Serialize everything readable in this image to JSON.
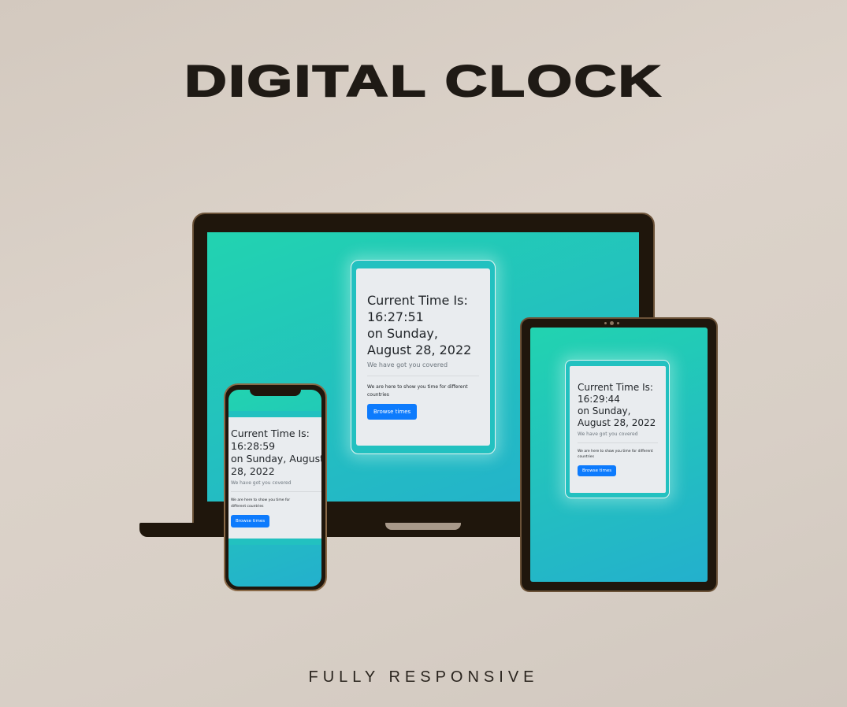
{
  "title": "DIGITAL CLOCK",
  "subtitle": "FULLY RESPONSIVE",
  "laptop": {
    "heading": "Current Time Is:",
    "time": "16:27:51",
    "date_line1": "on Sunday,",
    "date_line2": "August 28, 2022",
    "lead": "We have got you covered",
    "text": "We are here to show you time for different countries",
    "button": "Browse times"
  },
  "tablet": {
    "heading": "Current Time Is:",
    "time": "16:29:44",
    "date_line1": "on Sunday,",
    "date_line2": "August 28, 2022",
    "lead": "We have got you covered",
    "text": "We are here to show you time for different countries",
    "button": "Browse times"
  },
  "phone": {
    "heading": "Current Time Is:",
    "time": "16:28:59",
    "date_line1": "on Sunday, August",
    "date_line2": "28, 2022",
    "lead": "We have got you covered",
    "text": "We are here to show you time for different countries",
    "button": "Browse times"
  },
  "colors": {
    "accent": "#0d7bfd",
    "teal": "#22c1c0",
    "frame": "#1f160c"
  }
}
